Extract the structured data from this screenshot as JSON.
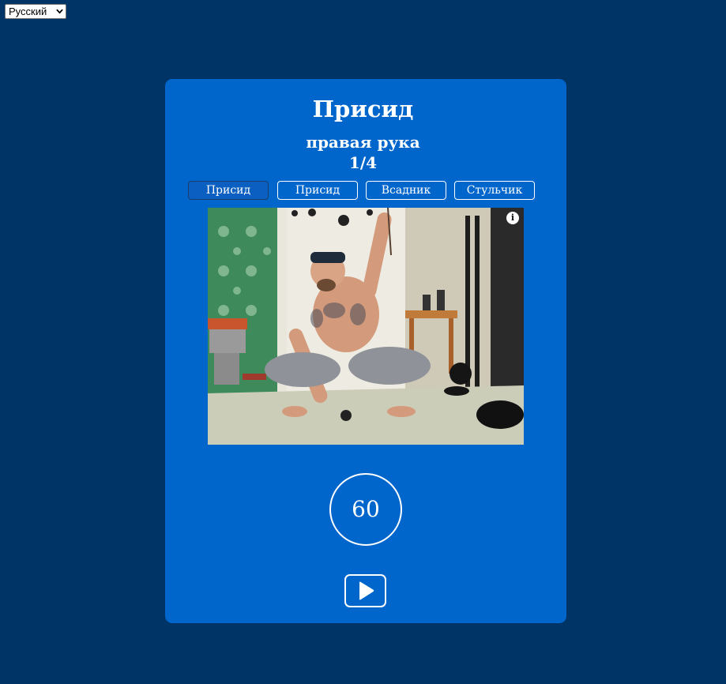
{
  "language_select": {
    "selected": "Русский",
    "icon": "chevron-down-icon"
  },
  "exercise": {
    "title": "Присид",
    "side": "правая рука",
    "progress": "1/4"
  },
  "tabs": [
    {
      "label": "Присид",
      "active": true
    },
    {
      "label": "Присид",
      "active": false
    },
    {
      "label": "Всадник",
      "active": false
    },
    {
      "label": "Стульчик",
      "active": false
    }
  ],
  "photo": {
    "icon": "info-icon",
    "info_glyph": "i"
  },
  "timer": {
    "value": "60"
  },
  "controls": {
    "play_icon": "play-icon"
  },
  "colors": {
    "background": "#003366",
    "card": "#0066cc",
    "text": "#ffffff"
  }
}
